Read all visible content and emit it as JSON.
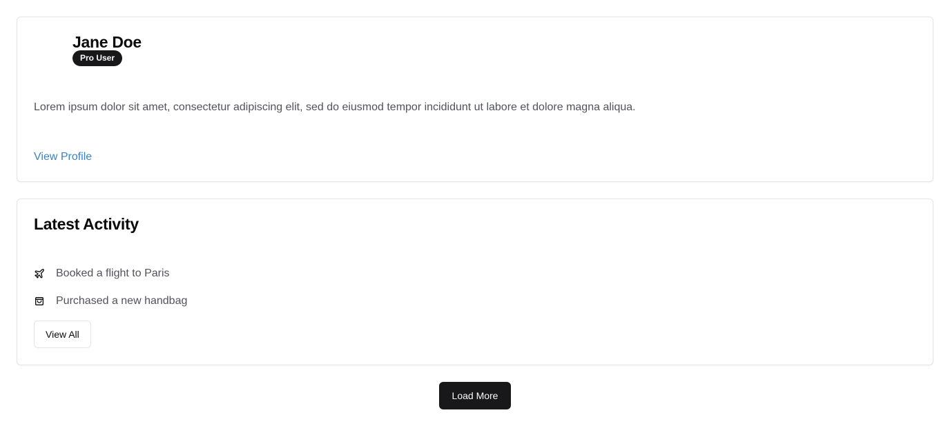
{
  "profile": {
    "name": "Jane Doe",
    "badge": "Pro User",
    "bio": "Lorem ipsum dolor sit amet, consectetur adipiscing elit, sed do eiusmod tempor incididunt ut labore et dolore magna aliqua.",
    "link_label": "View Profile"
  },
  "activity": {
    "title": "Latest Activity",
    "items": [
      {
        "icon": "plane-icon",
        "text": "Booked a flight to Paris"
      },
      {
        "icon": "shopping-bag-icon",
        "text": "Purchased a new handbag"
      }
    ],
    "view_all_label": "View All"
  },
  "footer": {
    "load_more_label": "Load More"
  },
  "colors": {
    "primary_dark": "#18181b",
    "link_blue": "#3b82c6",
    "muted_text": "#52525b",
    "border": "#e4e4e7"
  }
}
